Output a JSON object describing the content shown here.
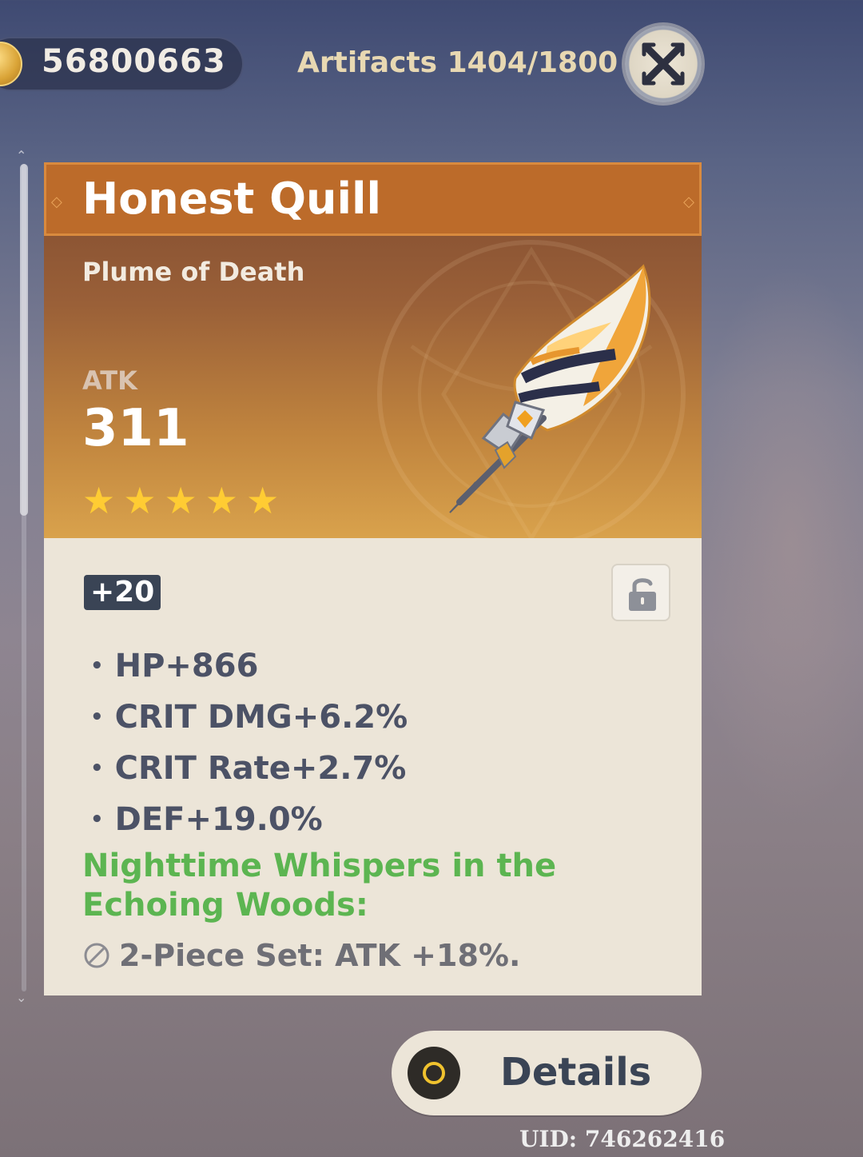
{
  "topbar": {
    "mora_value": "56800663",
    "artifacts_count": "Artifacts 1404/1800"
  },
  "artifact": {
    "name": "Honest Quill",
    "type": "Plume of Death",
    "main_stat_label": "ATK",
    "main_stat_value": "311",
    "rarity_stars": 5,
    "level": "+20",
    "locked": false,
    "substats": [
      "HP+866",
      "CRIT DMG+6.2%",
      "CRIT Rate+2.7%",
      "DEF+19.0%"
    ],
    "set_name": "Nighttime Whispers in the Echoing Woods:",
    "set_bonus": "2-Piece Set: ATK +18%."
  },
  "details_button": {
    "label": "Details"
  },
  "uid": "UID: 746262416",
  "colors": {
    "title_bar": "#bc6b2a",
    "set_name": "#5cb551",
    "star": "#ffcc33",
    "card_body": "#ece5d8"
  },
  "icons": [
    "mora-coin-icon",
    "close-icon",
    "lock-icon",
    "set-inactive-icon",
    "details-icon"
  ]
}
